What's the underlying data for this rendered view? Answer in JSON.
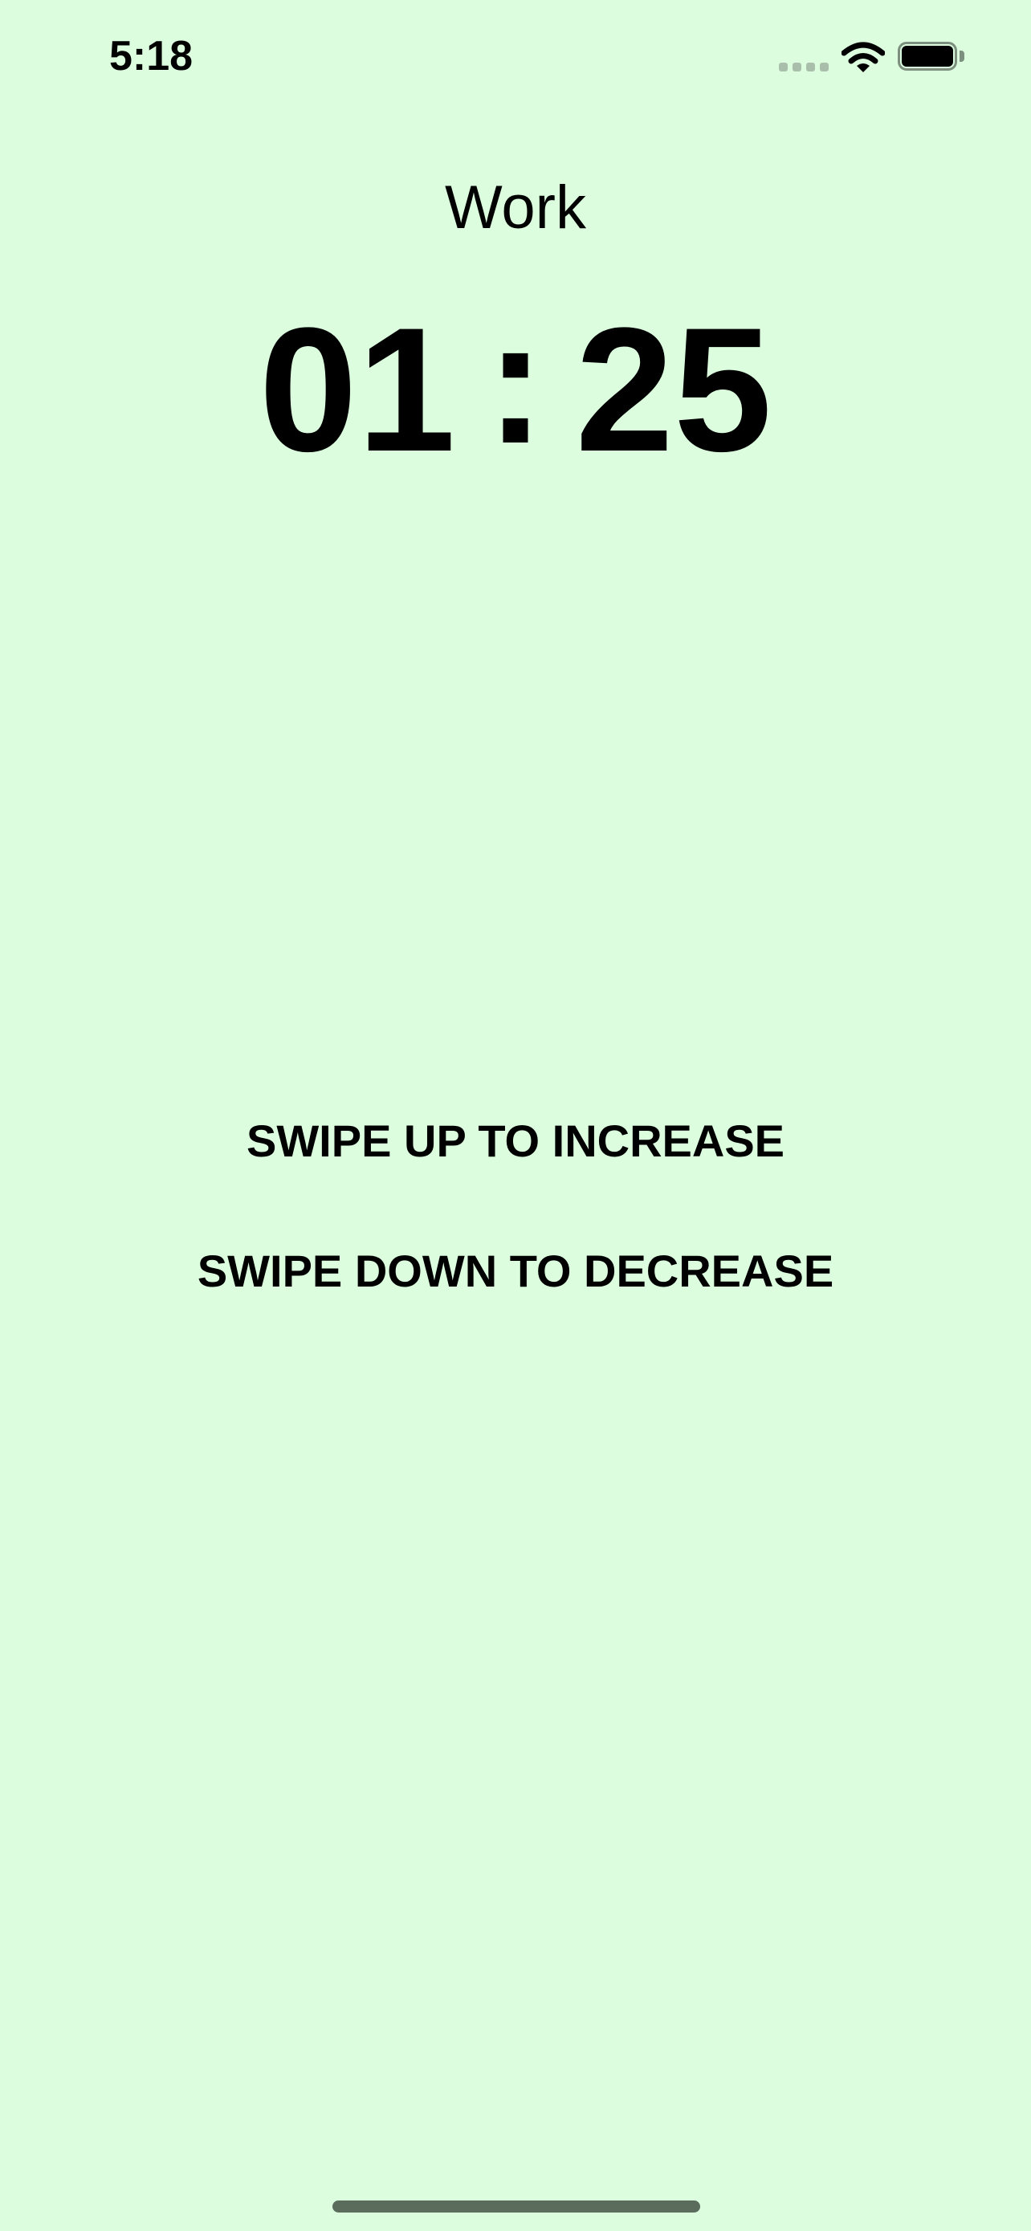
{
  "status_bar": {
    "time": "5:18",
    "icons": [
      "signal-icon",
      "wifi-icon",
      "battery-icon"
    ]
  },
  "timer_screen": {
    "mode_label": "Work",
    "minutes": "01",
    "separator": ":",
    "seconds": "25",
    "instructions": {
      "increase": "SWIPE UP TO INCREASE",
      "decrease": "SWIPE DOWN TO DECREASE"
    }
  },
  "colors": {
    "background": "#dcfedf",
    "text": "#000000"
  }
}
